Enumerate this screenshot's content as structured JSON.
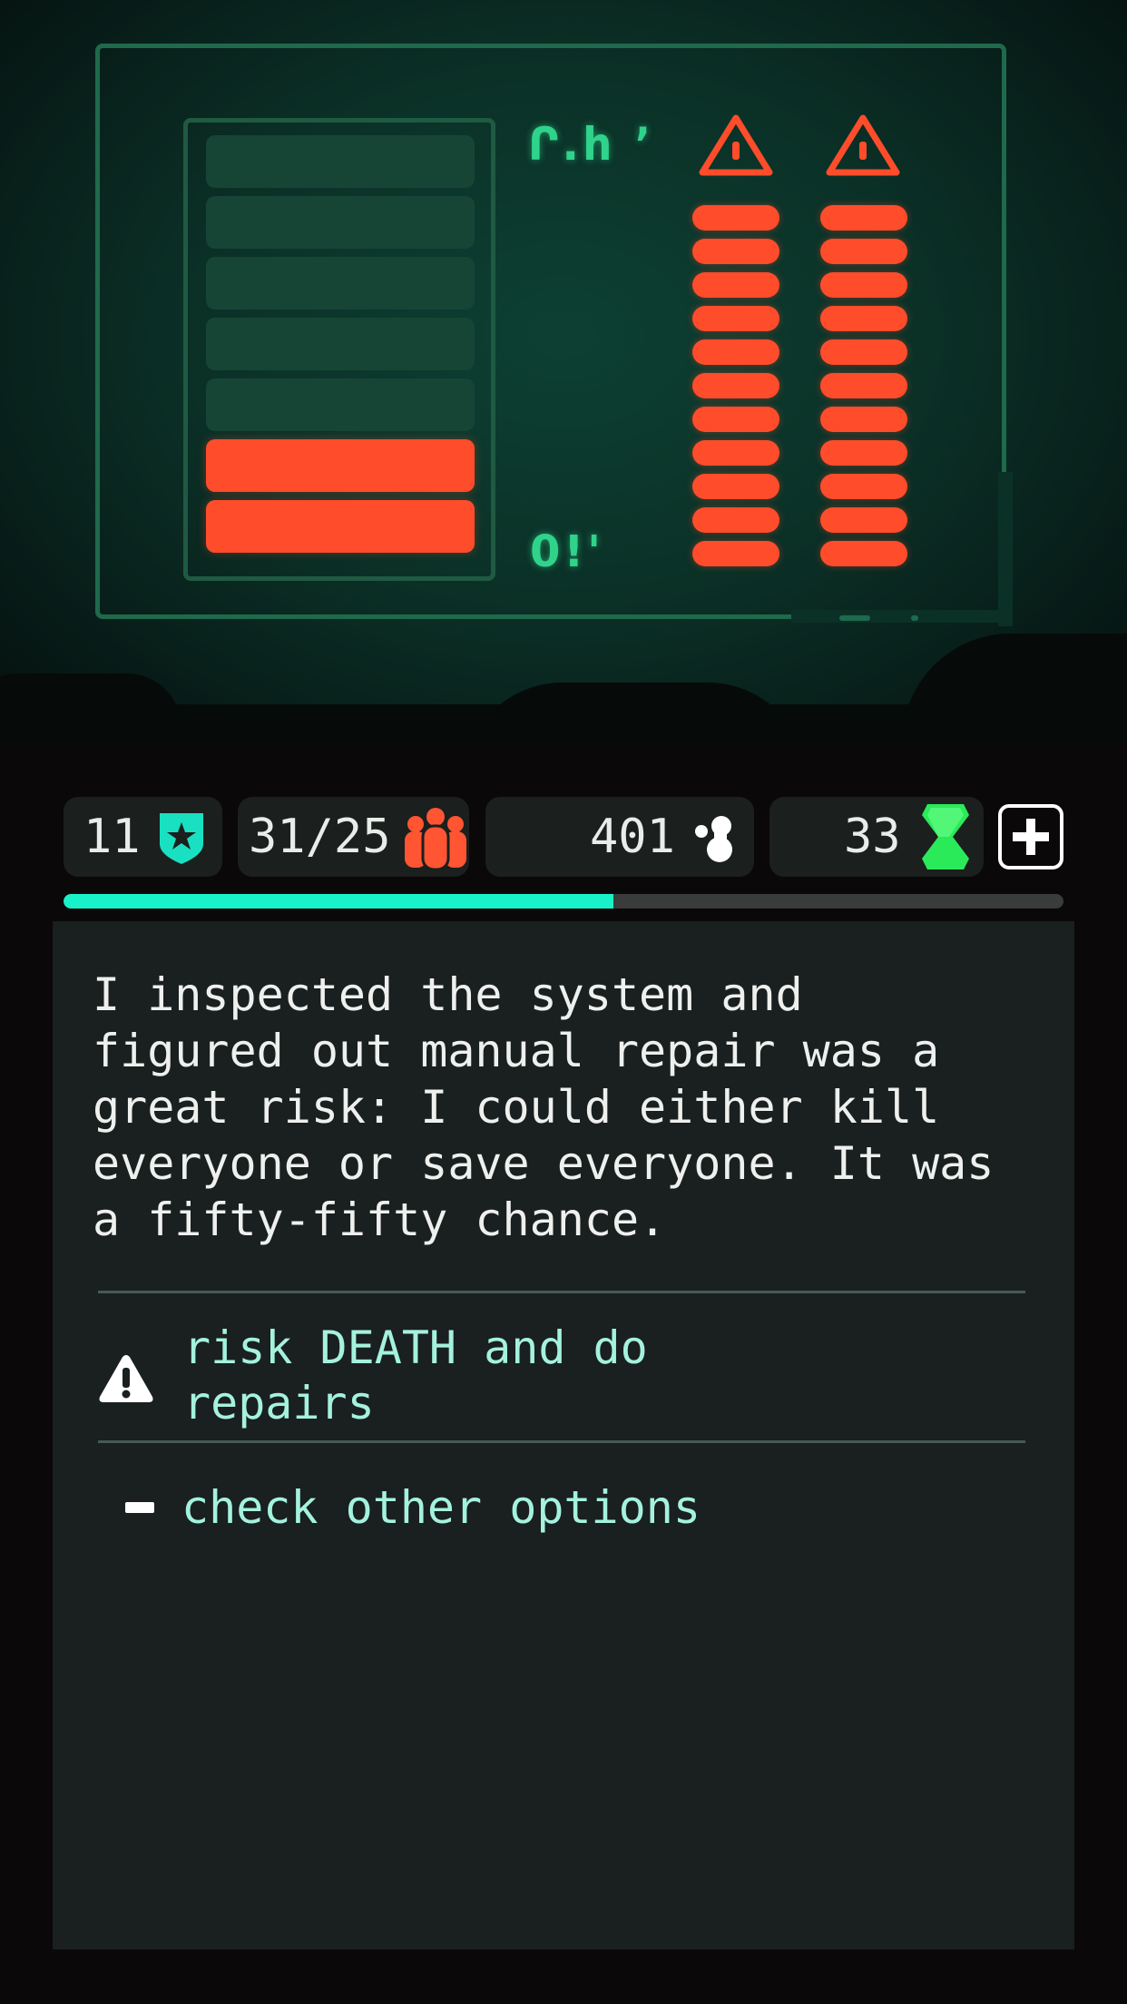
{
  "scene": {
    "glyphs_top": "Ր.հ ՚",
    "glyphs_bottom": "0!'",
    "meter": {
      "total_segments": 7,
      "lit_segments": 2
    },
    "warning_columns": [
      {
        "icon": "warning-triangle-icon",
        "segments": 11
      },
      {
        "icon": "warning-triangle-icon",
        "segments": 11
      }
    ],
    "colors": {
      "lit": "#ff4c2b",
      "unlit": "#164536",
      "frame": "#1f6a4c",
      "glyph": "#2fd38a"
    }
  },
  "stats": {
    "shield": {
      "value": "11",
      "icon": "shield-star-icon"
    },
    "crew": {
      "value": "31/25",
      "icon": "crew-group-icon"
    },
    "resource": {
      "value": "401",
      "icon": "blob-icon"
    },
    "crystal": {
      "value": "33",
      "icon": "green-crystal-icon"
    },
    "add_button_icon": "plus-icon"
  },
  "progress": {
    "fraction": 0.55,
    "color": "#19f2c8"
  },
  "story": {
    "text": "I inspected the system and\nfigured out manual repair was a\ngreat risk: I could either kill\neveryone or save everyone. It was\na fifty-fifty chance."
  },
  "choices": [
    {
      "icon": "warning-icon",
      "label": "risk DEATH and do\nrepairs"
    },
    {
      "icon": "dash-icon",
      "label": "check other options"
    }
  ]
}
